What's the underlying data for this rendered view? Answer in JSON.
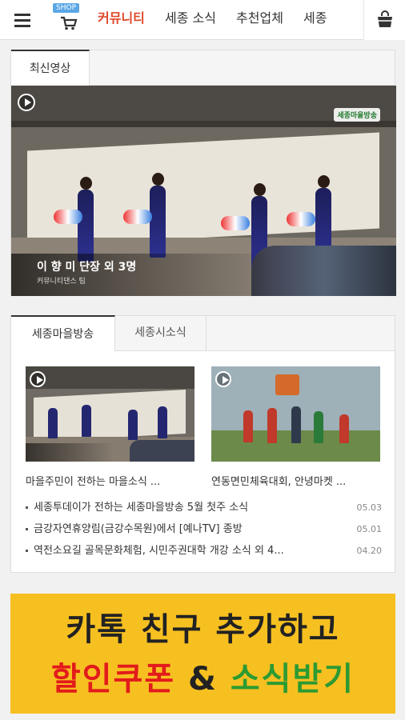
{
  "header": {
    "shop_badge": "SHOP",
    "nav": [
      "커뮤니티",
      "세종 소식",
      "추천업체",
      "세종"
    ],
    "active_index": 0,
    "accent_color": "#e0492a"
  },
  "featured": {
    "tab_label": "최신영상",
    "video_title": "이 향 미 단장 외 3명",
    "video_subtitle": "커뮤니티댄스 팀",
    "logo_text": "세종마을방송"
  },
  "broadcast": {
    "tabs": [
      "세종마을방송",
      "세종시소식"
    ],
    "active_tab": 0,
    "thumbnails": [
      {
        "caption": "마을주민이 전하는 마을소식 ..."
      },
      {
        "caption": "연동면민체육대회, 안녕마켓 ..."
      }
    ],
    "news": [
      {
        "title": "세종투데이가 전하는 세종마을방송 5월 첫주 소식",
        "date": "05.03"
      },
      {
        "title": "금강자연휴양림(금강수목원)에서 [예나TV] 종방",
        "date": "05.01"
      },
      {
        "title": "역전소요길 골목문화체험, 시민주권대학 개강 소식 외 4...",
        "date": "04.20"
      }
    ]
  },
  "promo": {
    "line1": "카톡 친구 추가하고",
    "line2_red": "할인쿠폰",
    "line2_amp": " & ",
    "line2_green": "소식받기",
    "bg_color": "#f7c021"
  }
}
